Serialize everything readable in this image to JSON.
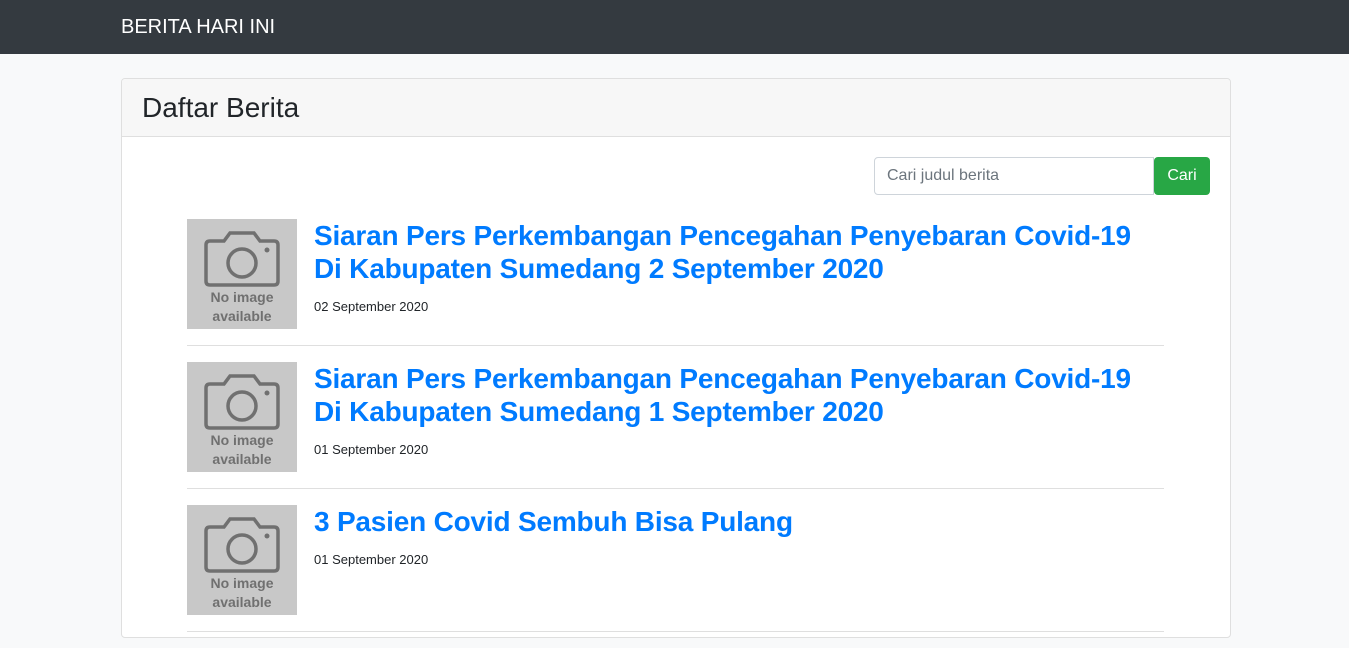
{
  "navbar": {
    "brand": "BERITA HARI INI"
  },
  "card": {
    "title": "Daftar Berita"
  },
  "search": {
    "placeholder": "Cari judul berita",
    "button_label": "Cari"
  },
  "news": [
    {
      "title": "Siaran Pers Perkembangan Pencegahan Penyebaran Covid-19 Di Kabupaten Sumedang 2 September 2020",
      "date": "02 September 2020",
      "thumb_line1": "No image",
      "thumb_line2": "available"
    },
    {
      "title": "Siaran Pers Perkembangan Pencegahan Penyebaran Covid-19 Di Kabupaten Sumedang 1 September 2020",
      "date": "01 September 2020",
      "thumb_line1": "No image",
      "thumb_line2": "available"
    },
    {
      "title": "3 Pasien Covid Sembuh Bisa Pulang",
      "date": "01 September 2020",
      "thumb_line1": "No image",
      "thumb_line2": "available"
    }
  ],
  "colors": {
    "navbar": "#343a40",
    "link": "#007bff",
    "button": "#28a745"
  },
  "icons": {
    "thumbnail": "camera-icon"
  }
}
